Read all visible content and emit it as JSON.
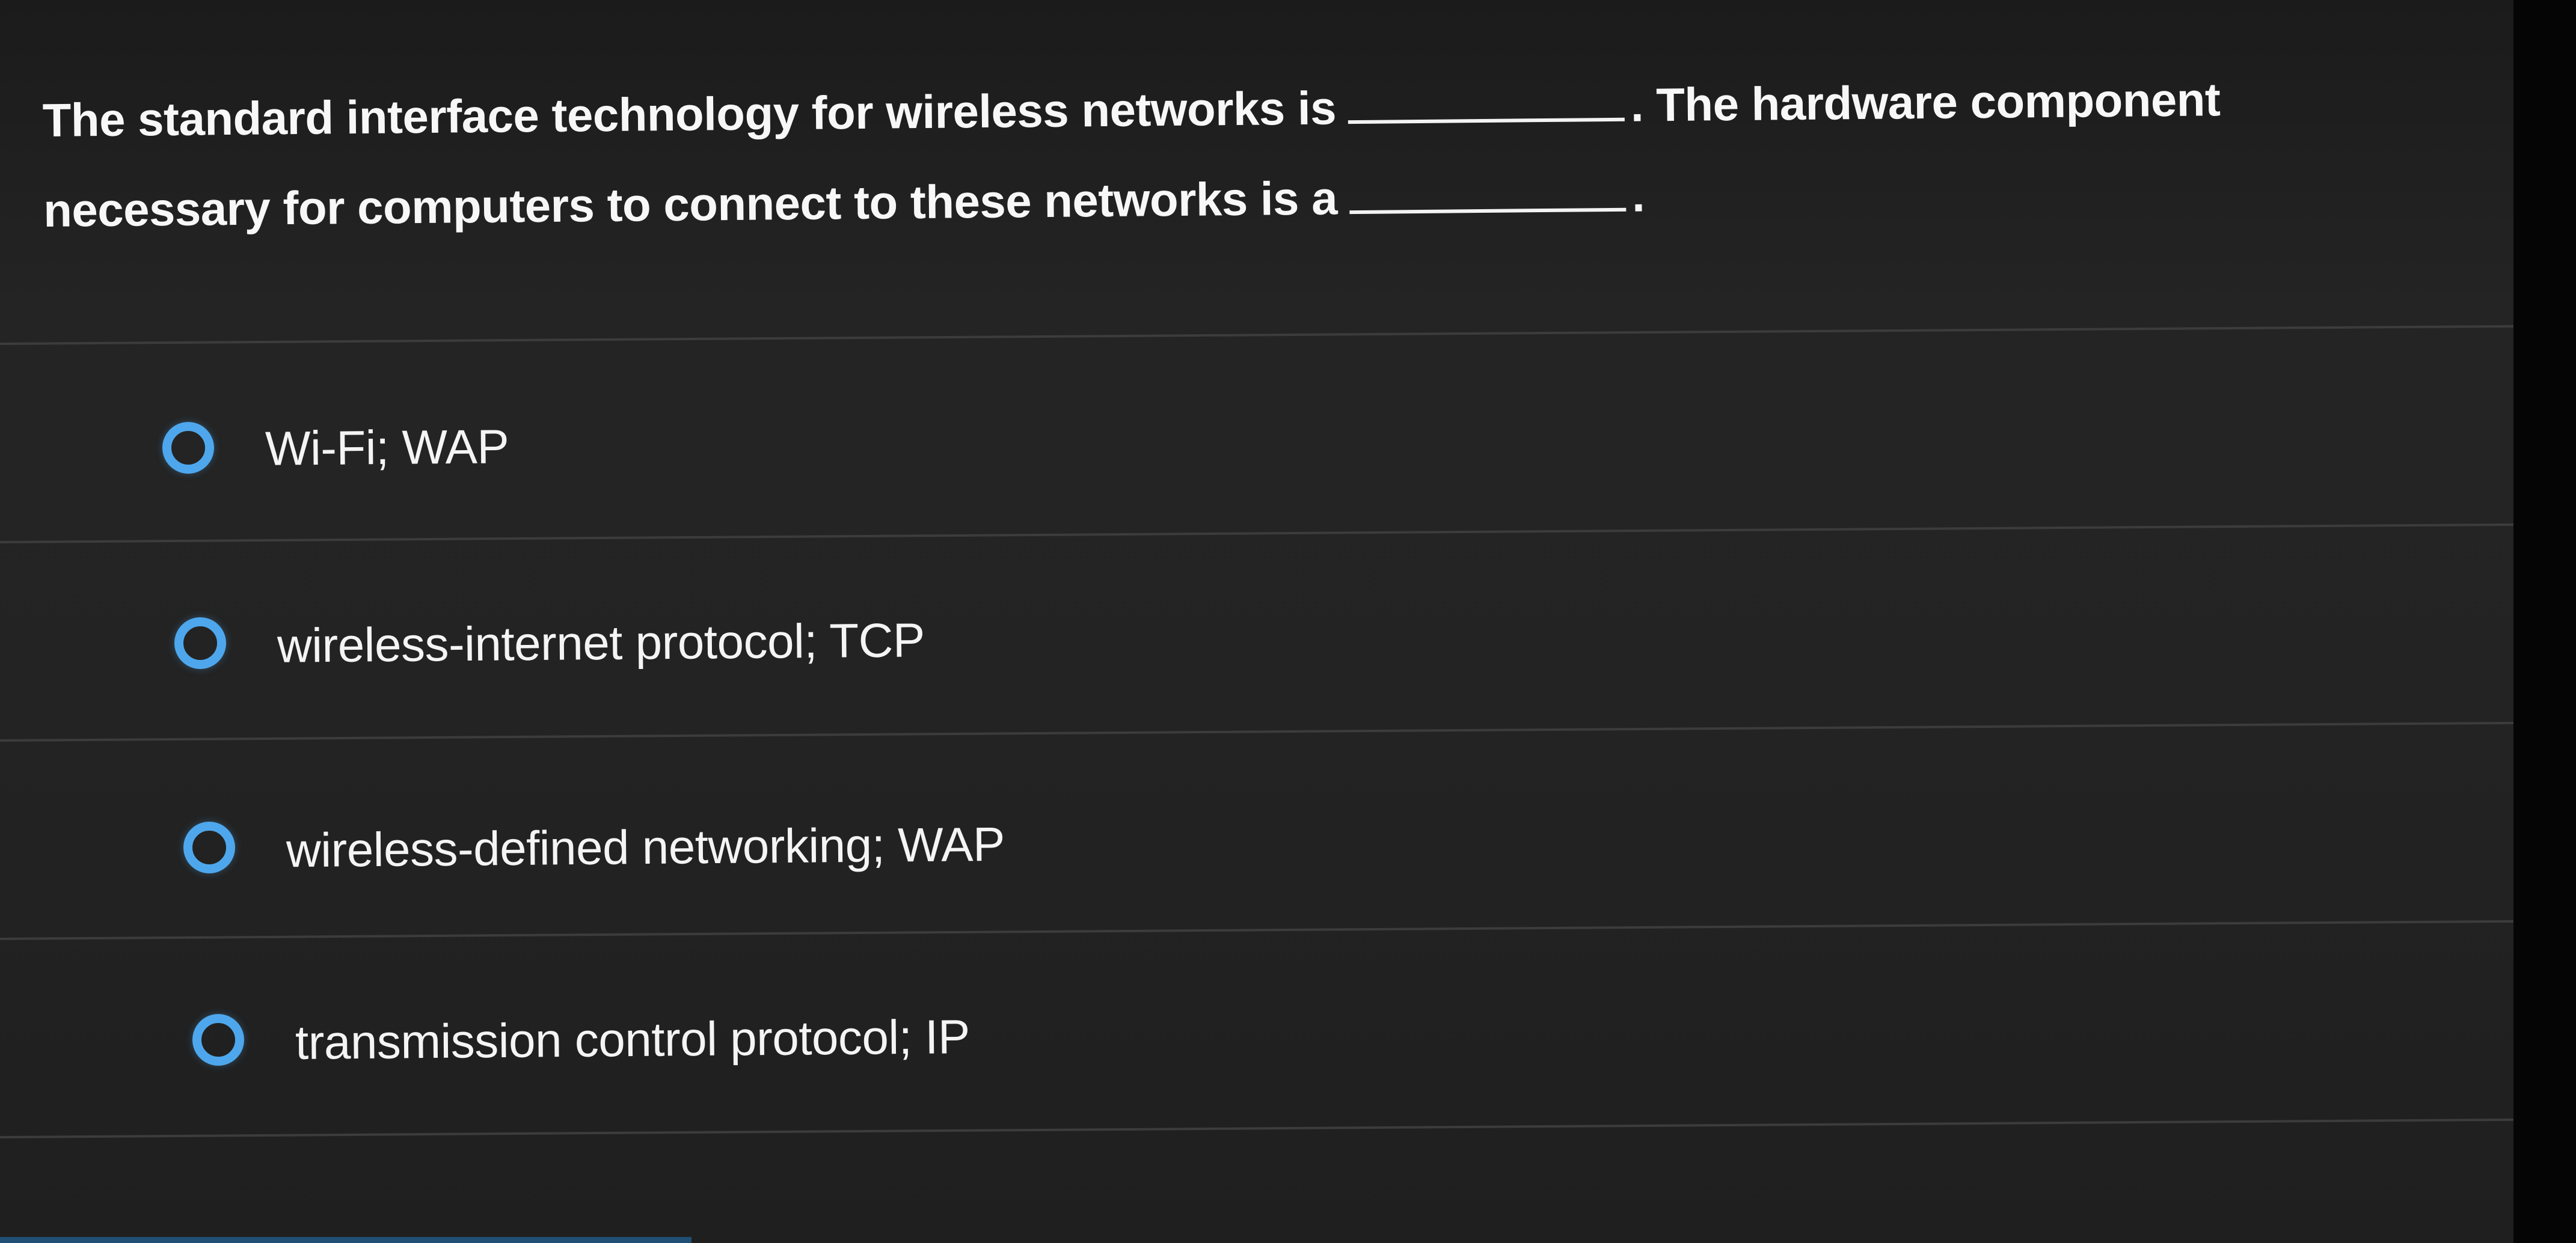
{
  "question": {
    "line1_before_blank": "The standard interface technology for wireless networks is",
    "line1_after_blank": ". The hardware component",
    "line2_before_blank": "necessary for computers to connect to these networks is a",
    "line2_after_blank": "."
  },
  "options": [
    {
      "label": "Wi-Fi; WAP",
      "selected": false
    },
    {
      "label": "wireless-internet protocol; TCP",
      "selected": false
    },
    {
      "label": "wireless-defined networking; WAP",
      "selected": false
    },
    {
      "label": "transmission control protocol; IP",
      "selected": false
    }
  ],
  "colors": {
    "background": "#232323",
    "text": "#f4f4f4",
    "radio_accent": "#4ea7ec",
    "divider": "#3c3c3c"
  },
  "icons": {
    "radio": "radio-unselected-icon"
  }
}
